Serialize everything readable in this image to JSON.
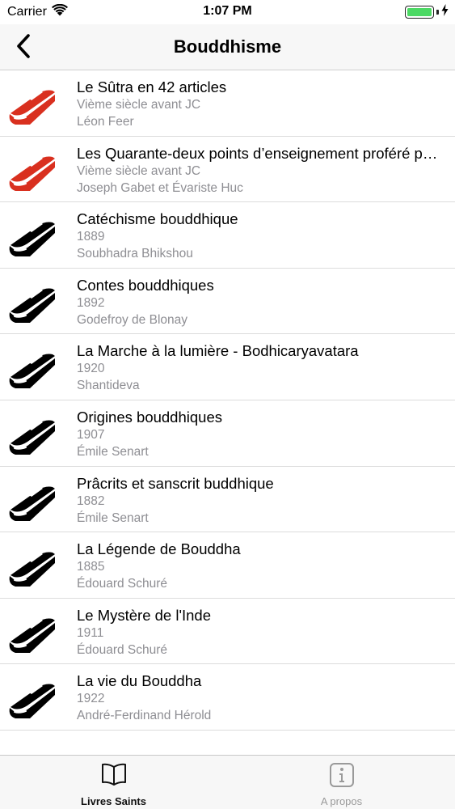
{
  "status_bar": {
    "carrier": "Carrier",
    "time": "1:07 PM",
    "battery_level": 1.0
  },
  "nav": {
    "title": "Bouddhisme",
    "back_icon": "chevron-left-icon"
  },
  "colors": {
    "book_red": "#d9301f",
    "book_black": "#000000",
    "secondary_text": "#8e8e93",
    "tab_active": "#111111",
    "tab_inactive": "#9a9a9a",
    "battery_green": "#4cd964"
  },
  "books": [
    {
      "title": "Le Sûtra en 42 articles",
      "date": "Vième siècle avant JC",
      "author": "Léon Feer",
      "icon": "book-icon",
      "highlight": true
    },
    {
      "title": "Les Quarante-deux points d’enseignement proféré par Bouddha",
      "date": "Vième siècle avant JC",
      "author": "Joseph Gabet et Évariste Huc",
      "icon": "book-icon",
      "highlight": true
    },
    {
      "title": "Catéchisme bouddhique",
      "date": "1889",
      "author": "Soubhadra Bhikshou",
      "icon": "book-icon",
      "highlight": false
    },
    {
      "title": "Contes bouddhiques",
      "date": "1892",
      "author": "Godefroy de Blonay",
      "icon": "book-icon",
      "highlight": false
    },
    {
      "title": "La Marche à la lumière - Bodhicaryavatara",
      "date": "1920",
      "author": "Shantideva",
      "icon": "book-icon",
      "highlight": false
    },
    {
      "title": "Origines bouddhiques",
      "date": "1907",
      "author": "Émile Senart",
      "icon": "book-icon",
      "highlight": false
    },
    {
      "title": "Prâcrits et sanscrit buddhique",
      "date": "1882",
      "author": "Émile Senart",
      "icon": "book-icon",
      "highlight": false
    },
    {
      "title": "La Légende de Bouddha",
      "date": "1885",
      "author": "Édouard Schuré",
      "icon": "book-icon",
      "highlight": false
    },
    {
      "title": "Le Mystère de l'Inde",
      "date": "1911",
      "author": "Édouard Schuré",
      "icon": "book-icon",
      "highlight": false
    },
    {
      "title": "La vie du Bouddha",
      "date": "1922",
      "author": "André-Ferdinand Hérold",
      "icon": "book-icon",
      "highlight": false
    }
  ],
  "tabs": [
    {
      "label": "Livres Saints",
      "icon": "open-book-icon",
      "active": true
    },
    {
      "label": "A propos",
      "icon": "info-icon",
      "active": false
    }
  ]
}
